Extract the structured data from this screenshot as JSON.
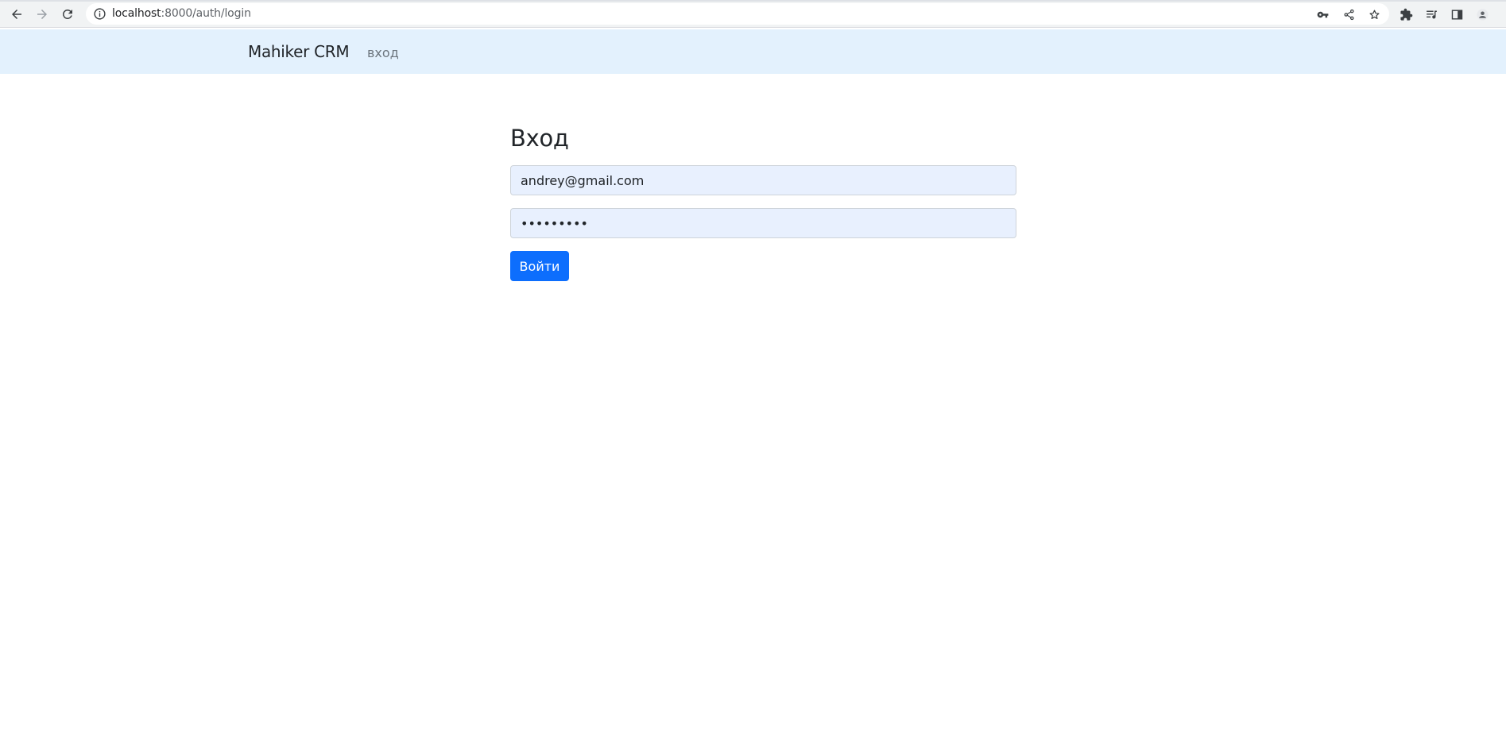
{
  "browser": {
    "url_host": "localhost",
    "url_path": ":8000/auth/login",
    "icons": [
      "back-icon",
      "forward-icon",
      "reload-icon",
      "site-info-icon",
      "key-icon",
      "share-icon",
      "star-icon",
      "extensions-icon",
      "reading-list-icon",
      "side-panel-icon",
      "profile-icon"
    ]
  },
  "navbar": {
    "brand": "Mahiker CRM",
    "link": "вход",
    "background": "#e3f1fd"
  },
  "login": {
    "title": "Вход",
    "email_value": "andrey@gmail.com",
    "password_value": "•••••••••",
    "submit_label": "Войти",
    "accent": "#0d6efd",
    "autofill_bg": "#e8f0fe"
  }
}
